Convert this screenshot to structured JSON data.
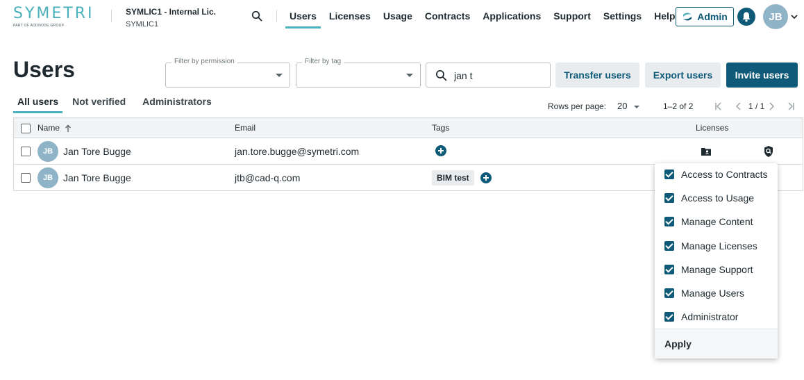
{
  "header": {
    "logo_text": "SYMETRI",
    "logo_subtext": "PART OF ADDNODE GROUP",
    "org_name": "SYMLIC1 - Internal Lic.",
    "org_code": "SYMLIC1",
    "search_icon": "search-icon",
    "nav": [
      {
        "label": "Users",
        "active": true
      },
      {
        "label": "Licenses",
        "active": false
      },
      {
        "label": "Usage",
        "active": false
      },
      {
        "label": "Contracts",
        "active": false
      },
      {
        "label": "Applications",
        "active": false
      },
      {
        "label": "Support",
        "active": false
      },
      {
        "label": "Settings",
        "active": false
      },
      {
        "label": "Help",
        "active": false
      }
    ],
    "admin_label": "Admin",
    "user_initials": "JB"
  },
  "page": {
    "title": "Users"
  },
  "filters": {
    "permission_label": "Filter by permission",
    "permission_value": "",
    "tag_label": "Filter by tag",
    "tag_value": "",
    "search_value": "jan t"
  },
  "actions": {
    "transfer": "Transfer users",
    "export": "Export users",
    "invite": "Invite users"
  },
  "tabs": [
    {
      "label": "All users",
      "active": true
    },
    {
      "label": "Not verified",
      "active": false
    },
    {
      "label": "Administrators",
      "active": false
    }
  ],
  "pagination": {
    "rows_per_page_label": "Rows per page:",
    "rows_per_page": "20",
    "range": "1–2 of 2",
    "page": "1 / 1"
  },
  "table": {
    "columns": {
      "name": "Name",
      "email": "Email",
      "tags": "Tags",
      "licenses": "Licenses"
    },
    "rows": [
      {
        "initials": "JB",
        "name": "Jan Tore Bugge",
        "email": "jan.tore.bugge@symetri.com",
        "tags": []
      },
      {
        "initials": "JB",
        "name": "Jan Tore Bugge",
        "email": "jtb@cad-q.com",
        "tags": [
          "BIM test"
        ]
      }
    ]
  },
  "permissions_popup": {
    "items": [
      {
        "label": "Access to Contracts",
        "checked": true
      },
      {
        "label": "Access to Usage",
        "checked": true
      },
      {
        "label": "Manage Content",
        "checked": true
      },
      {
        "label": "Manage Licenses",
        "checked": true
      },
      {
        "label": "Manage Support",
        "checked": true
      },
      {
        "label": "Manage Users",
        "checked": true
      },
      {
        "label": "Administrator",
        "checked": true
      }
    ],
    "apply_label": "Apply"
  },
  "colors": {
    "brand_teal": "#4ab1bd",
    "primary": "#0e5a78",
    "avatar": "#8fb3c7"
  }
}
